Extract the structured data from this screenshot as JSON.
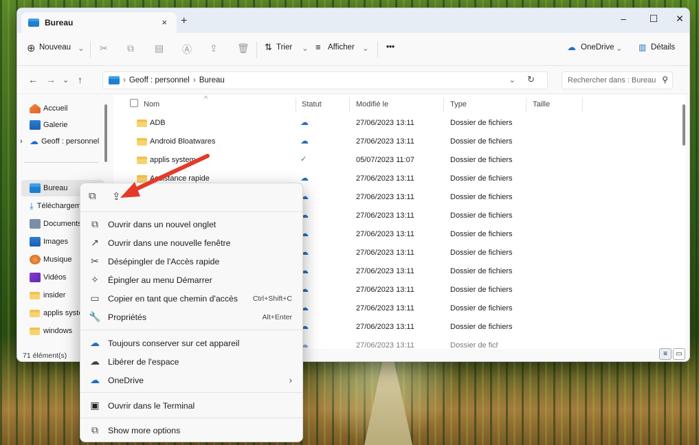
{
  "tab": {
    "title": "Bureau",
    "close": "×",
    "new": "+"
  },
  "window": {
    "minimize": "–",
    "maximize": "☐",
    "close": "✕"
  },
  "toolbar": {
    "new": "Nouveau",
    "new_caret": "⌄",
    "sort": "Trier",
    "view": "Afficher",
    "more": "•••",
    "onedrive": "OneDrive",
    "details": "Détails"
  },
  "address": {
    "back": "←",
    "forward": "→",
    "down": "⌄",
    "up": "↑",
    "segments": [
      "Geoff : personnel",
      "Bureau"
    ],
    "sep": "›",
    "dropdown": "⌄",
    "refresh": "↻",
    "search_placeholder": "Rechercher dans : Bureau",
    "search_icon": "⚲"
  },
  "sidebar": {
    "items": [
      "Accueil",
      "Galerie",
      "Geoff : personnel",
      "Bureau",
      "Téléchargements",
      "Documents",
      "Images",
      "Musique",
      "Vidéos",
      "insider",
      "applis system",
      "windows"
    ],
    "chevron": "›",
    "pin": "📌"
  },
  "columns": {
    "name": "Nom",
    "status": "Statut",
    "modified": "Modifié le",
    "type": "Type",
    "size": "Taille"
  },
  "rows": [
    {
      "name": "ADB",
      "status": "☁",
      "date": "27/06/2023 13:11",
      "type": "Dossier de fichiers"
    },
    {
      "name": "Android Bloatwares",
      "status": "☁",
      "date": "27/06/2023 13:11",
      "type": "Dossier de fichiers"
    },
    {
      "name": "applis system",
      "status": "✓",
      "date": "05/07/2023 11:07",
      "type": "Dossier de fichiers"
    },
    {
      "name": "Assistance rapide",
      "status": "☁",
      "date": "27/06/2023 13:11",
      "type": "Dossier de fichiers"
    },
    {
      "name": "",
      "status": "☁",
      "date": "27/06/2023 13:11",
      "type": "Dossier de fichiers"
    },
    {
      "name": "",
      "status": "☁",
      "date": "27/06/2023 13:11",
      "type": "Dossier de fichiers"
    },
    {
      "name": "",
      "status": "☁",
      "date": "27/06/2023 13:11",
      "type": "Dossier de fichiers"
    },
    {
      "name": "",
      "status": "☁",
      "date": "27/06/2023 13:11",
      "type": "Dossier de fichiers"
    },
    {
      "name": "",
      "status": "☁",
      "date": "27/06/2023 13:11",
      "type": "Dossier de fichiers"
    },
    {
      "name": "",
      "status": "☁",
      "date": "27/06/2023 13:11",
      "type": "Dossier de fichiers"
    },
    {
      "name": "",
      "status": "☁",
      "date": "27/06/2023 13:11",
      "type": "Dossier de fichiers"
    },
    {
      "name": "",
      "status": "☁",
      "date": "27/06/2023 13:11",
      "type": "Dossier de fichiers"
    },
    {
      "name": "",
      "status": "☁",
      "date": "27/06/2023 13:11",
      "type": "Dossier de fichiers"
    }
  ],
  "status": {
    "count": "71 élément(s)"
  },
  "menu": {
    "top_icons": {
      "copy": "⧉",
      "share": "⇪"
    },
    "items": [
      {
        "label": "Ouvrir dans un nouvel onglet",
        "icon": "⧉",
        "shortcut": ""
      },
      {
        "label": "Ouvrir dans une nouvelle fenêtre",
        "icon": "↗",
        "shortcut": ""
      },
      {
        "label": "Désépingler de l'Accès rapide",
        "icon": "✂",
        "shortcut": ""
      },
      {
        "label": "Épingler au menu Démarrer",
        "icon": "✧",
        "shortcut": ""
      },
      {
        "label": "Copier en tant que chemin d'accès",
        "icon": "▭",
        "shortcut": "Ctrl+Shift+C"
      },
      {
        "label": "Propriétés",
        "icon": "🔧",
        "shortcut": "Alt+Enter"
      },
      {
        "label": "Toujours conserver sur cet appareil",
        "icon": "☁",
        "shortcut": ""
      },
      {
        "label": "Libérer de l'espace",
        "icon": "☁",
        "shortcut": ""
      },
      {
        "label": "OneDrive",
        "icon": "☁",
        "shortcut": "›"
      },
      {
        "label": "Ouvrir dans le Terminal",
        "icon": "▣",
        "shortcut": ""
      },
      {
        "label": "Show more options",
        "icon": "⧉",
        "shortcut": ""
      }
    ]
  },
  "colors": {
    "accent": "#e53a2a",
    "folder": "#f3c04a",
    "onedrive": "#1f6fc7"
  }
}
